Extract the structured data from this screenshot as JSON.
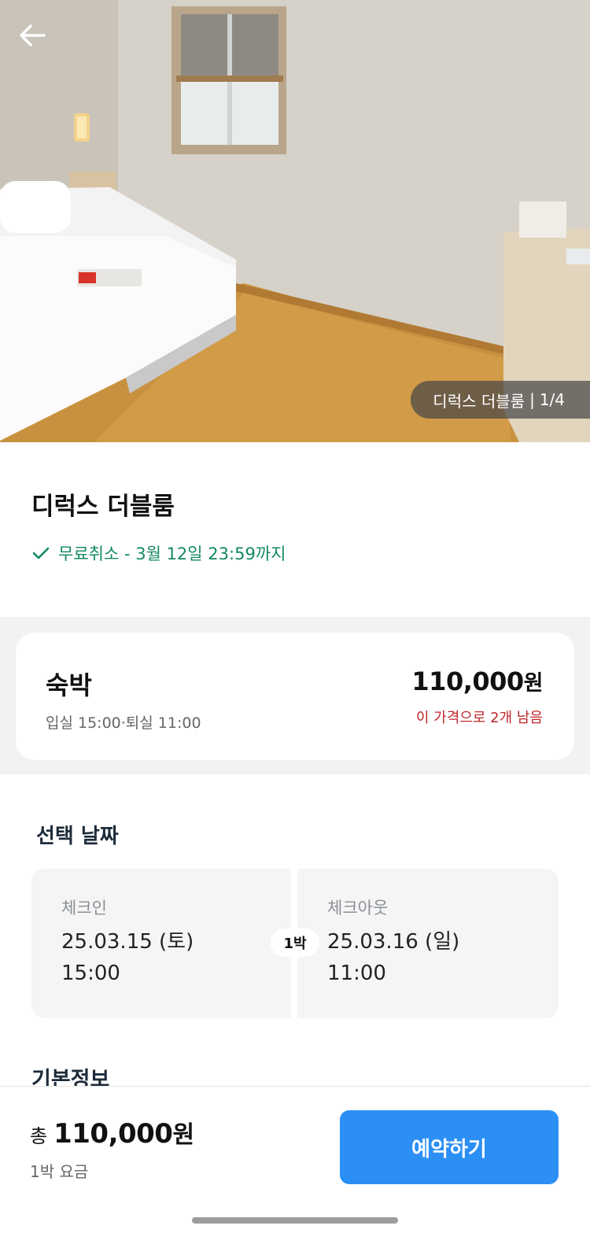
{
  "hero": {
    "photo_room_name": "디럭스 더블룸",
    "photo_counter": "1/4",
    "back_icon": "arrow-left-icon"
  },
  "room": {
    "title": "디럭스 더블룸",
    "free_cancel": "무료취소 - 3월 12일 23:59까지",
    "free_cancel_icon": "checkmark-icon",
    "accent_color": "#138a5d"
  },
  "option": {
    "name": "숙박",
    "times": "입실 15:00·퇴실 11:00",
    "price": "110,000",
    "currency": "원",
    "remaining": "이 가격으로 2개 남음",
    "remaining_color": "#c0262c"
  },
  "dates": {
    "title": "선택 날짜",
    "checkin_label": "체크인",
    "checkin_date": "25.03.15 (토)",
    "checkin_time": "15:00",
    "nights": "1박",
    "checkout_label": "체크아웃",
    "checkout_date": "25.03.16 (일)",
    "checkout_time": "11:00"
  },
  "basic_info": {
    "title": "기본정보"
  },
  "bottom_bar": {
    "total_prefix": "총",
    "total_price": "110,000",
    "currency": "원",
    "subtitle": "1박 요금",
    "reserve_label": "예약하기",
    "button_color": "#2b8ff5"
  }
}
